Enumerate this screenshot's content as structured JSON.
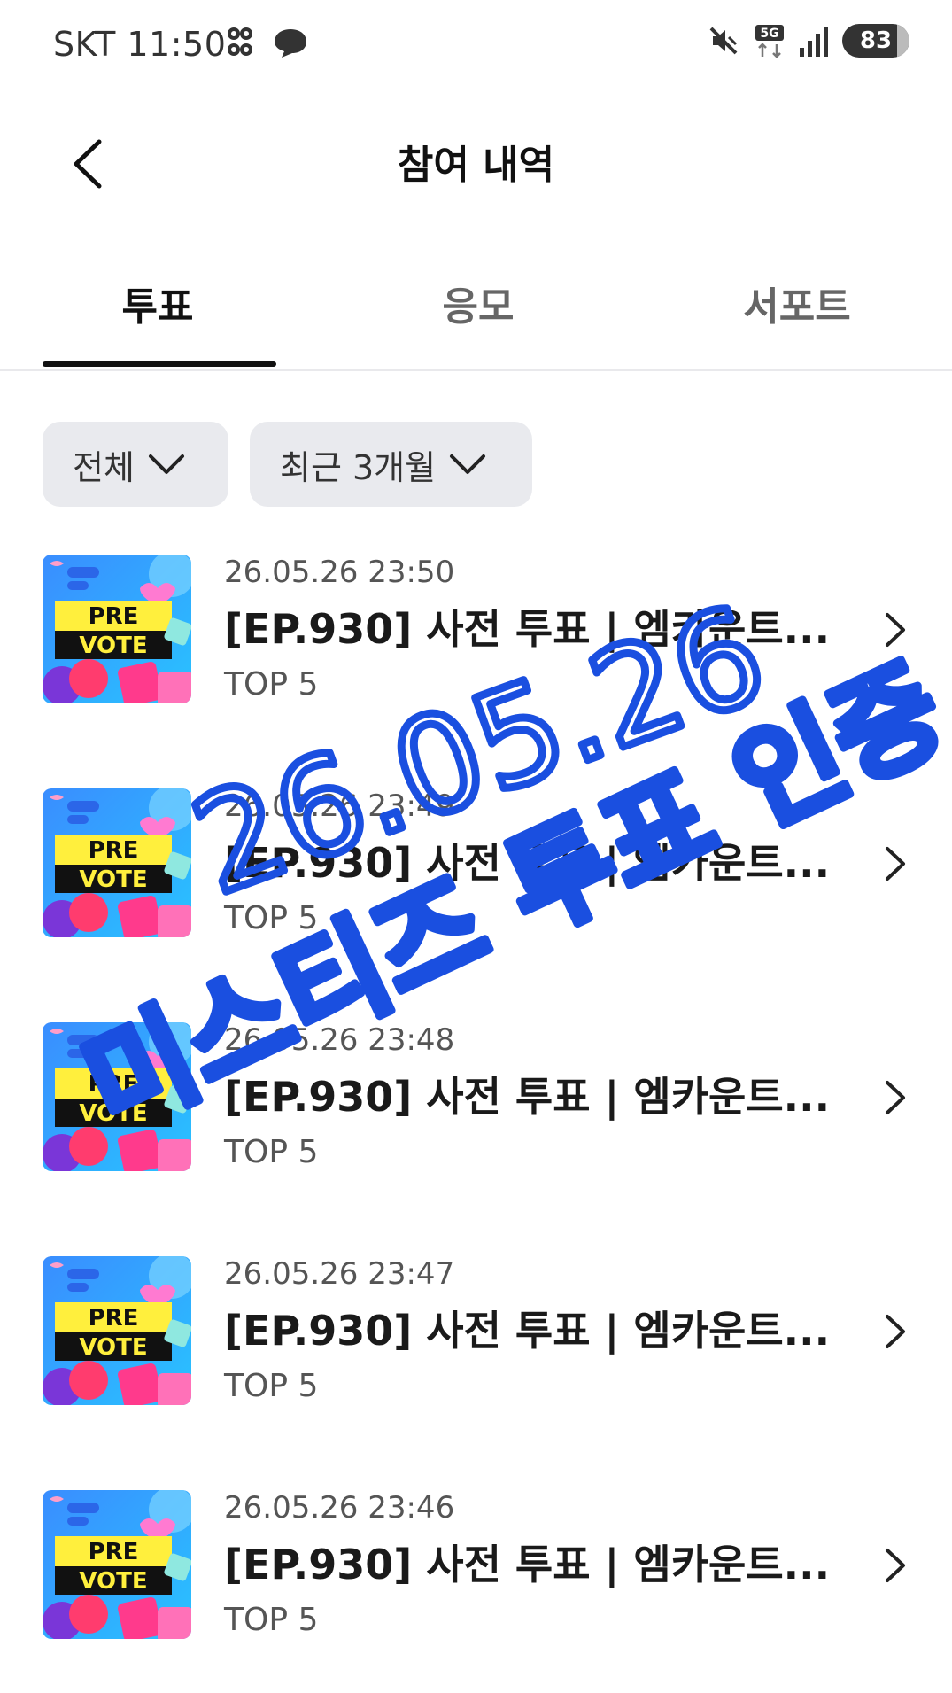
{
  "status_bar": {
    "carrier_time": "SKT 11:50",
    "battery": "83"
  },
  "header": {
    "title": "참여 내역"
  },
  "tabs": [
    {
      "label": "투표",
      "selected": true
    },
    {
      "label": "응모",
      "selected": false
    },
    {
      "label": "서포트",
      "selected": false
    }
  ],
  "filters": {
    "category": "전체",
    "period": "최근 3개월"
  },
  "items": [
    {
      "date": "26.05.26 23:50",
      "title": "[EP.930] 사전 투표 | 엠카운트...",
      "sub": "TOP 5"
    },
    {
      "date": "26.05.26 23:49",
      "title": "[EP.930] 사전 투표 | 엠카운트...",
      "sub": "TOP 5"
    },
    {
      "date": "26.05.26 23:48",
      "title": "[EP.930] 사전 투표 | 엠카운트...",
      "sub": "TOP 5"
    },
    {
      "date": "26.05.26 23:47",
      "title": "[EP.930] 사전 투표 | 엠카운트...",
      "sub": "TOP 5"
    },
    {
      "date": "26.05.26 23:46",
      "title": "[EP.930] 사전 투표 | 엠카운트...",
      "sub": "TOP 5"
    }
  ],
  "thumbnail": {
    "line1": "PRE",
    "line2": "VOTE"
  },
  "handwriting": {
    "line1": "26.05.26",
    "line2": "미스티즈 투표 인증",
    "color": "#1a4fe0"
  }
}
